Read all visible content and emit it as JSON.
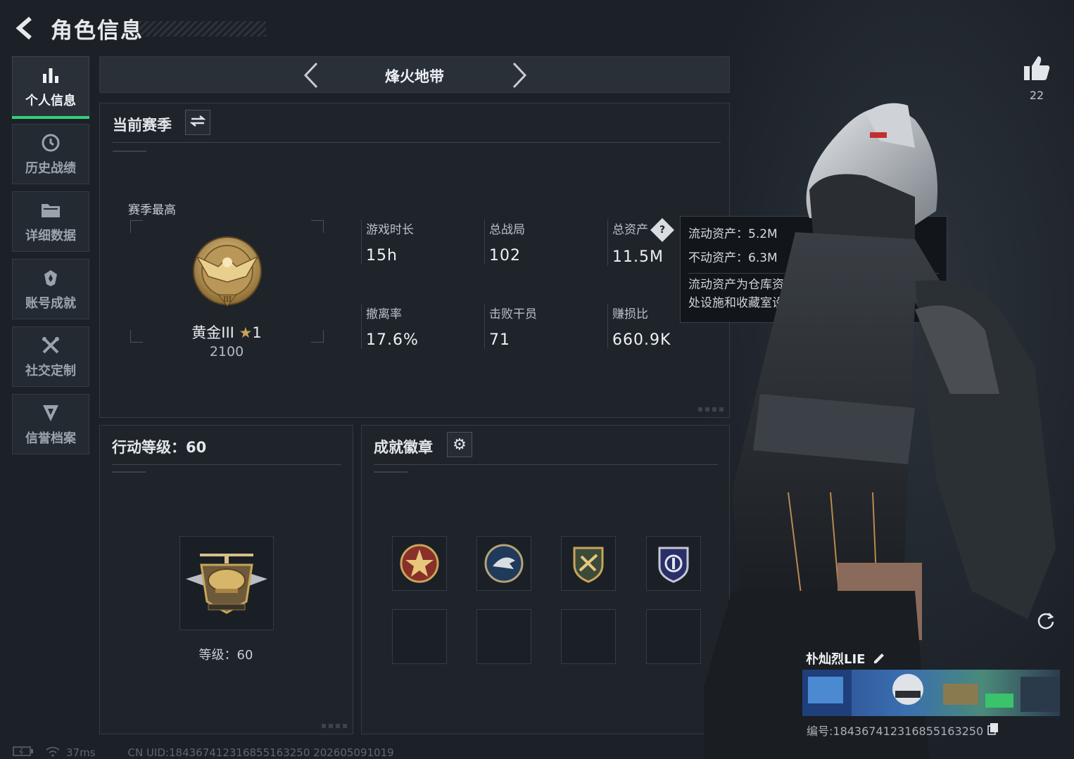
{
  "header": {
    "title": "角色信息"
  },
  "sidebar": {
    "items": [
      {
        "label": "个人信息",
        "icon": "bar-chart-icon",
        "active": true
      },
      {
        "label": "历史战绩",
        "icon": "history-clock-icon"
      },
      {
        "label": "详细数据",
        "icon": "folder-icon"
      },
      {
        "label": "账号成就",
        "icon": "achievement-icon"
      },
      {
        "label": "社交定制",
        "icon": "tools-icon"
      },
      {
        "label": "信誉档案",
        "icon": "credit-shield-icon"
      }
    ]
  },
  "mode": {
    "title": "烽火地带"
  },
  "season": {
    "title": "当前赛季",
    "best_label": "赛季最高",
    "rank_name": "黄金III",
    "rank_stars": "1",
    "rank_score": "2100"
  },
  "stats": [
    {
      "label": "游戏时长",
      "value": "15h"
    },
    {
      "label": "总战局",
      "value": "102"
    },
    {
      "label": "总资产",
      "value": "11.5M"
    },
    {
      "label": "撤离率",
      "value": "17.6%"
    },
    {
      "label": "击败干员",
      "value": "71"
    },
    {
      "label": "赚损比",
      "value": "660.9K"
    }
  ],
  "tooltip": {
    "liquid": "流动资产：5.2M",
    "fixed": "不动资产：6.3M",
    "desc": "流动资产为仓库资产和哈夫币，不动资产为特勤处设施和收藏室设施"
  },
  "level": {
    "title": "行动等级：60",
    "text": "等级：60"
  },
  "badges": {
    "title": "成就徽章"
  },
  "like": {
    "count": "22"
  },
  "player": {
    "name": "朴灿烈LIE",
    "id": "编号:184367412316855163250"
  },
  "status": {
    "ping": "37ms",
    "uid": "CN UID:184367412316855163250 202605091019"
  },
  "colors": {
    "accent": "#33d17a",
    "panel": "#1f242b",
    "background": "#1c2128",
    "gold": "#c9a55a"
  }
}
